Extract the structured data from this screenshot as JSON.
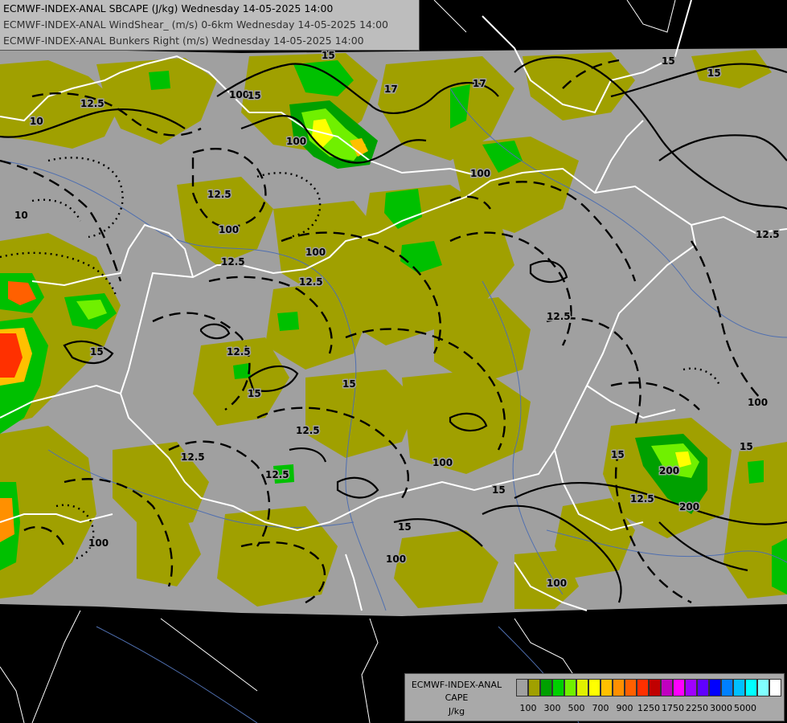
{
  "titles": [
    "ECMWF-INDEX-ANAL SBCAPE (J/kg) Wednesday 14-05-2025 14:00",
    "ECMWF-INDEX-ANAL WindShear_ (m/s) 0-6km Wednesday 14-05-2025 14:00",
    "ECMWF-INDEX-ANAL Bunkers Right (m/s) Wednesday 14-05-2025 14:00"
  ],
  "legend": {
    "title_lines": [
      "ECMWF-INDEX-ANAL",
      "CAPE",
      "J/kg"
    ],
    "colors": [
      "#a0a0a0",
      "#a0a000",
      "#00a000",
      "#00d000",
      "#70f000",
      "#e0f000",
      "#ffff00",
      "#ffc000",
      "#ff9000",
      "#ff6000",
      "#ff3000",
      "#c00000",
      "#c000c0",
      "#ff00ff",
      "#a000ff",
      "#6000ff",
      "#0000ff",
      "#0080ff",
      "#00c0ff",
      "#00ffff",
      "#80ffff",
      "#ffffff"
    ],
    "tick_labels": [
      "100",
      "300",
      "500",
      "700",
      "900",
      "1250",
      "1750",
      "2250",
      "3000",
      "5000"
    ]
  },
  "contour_labels": [
    "15",
    "17",
    "12.5",
    "10",
    "100",
    "15",
    "12.5",
    "15",
    "12.5",
    "100",
    "12.5",
    "15",
    "12.5",
    "15",
    "100",
    "12.5",
    "100",
    "15",
    "100",
    "17",
    "15",
    "12.5",
    "100",
    "15",
    "100",
    "10",
    "12.5",
    "12.5",
    "200",
    "200",
    "15",
    "100",
    "12.5",
    "100",
    "15",
    "100",
    "15",
    "12.5"
  ]
}
